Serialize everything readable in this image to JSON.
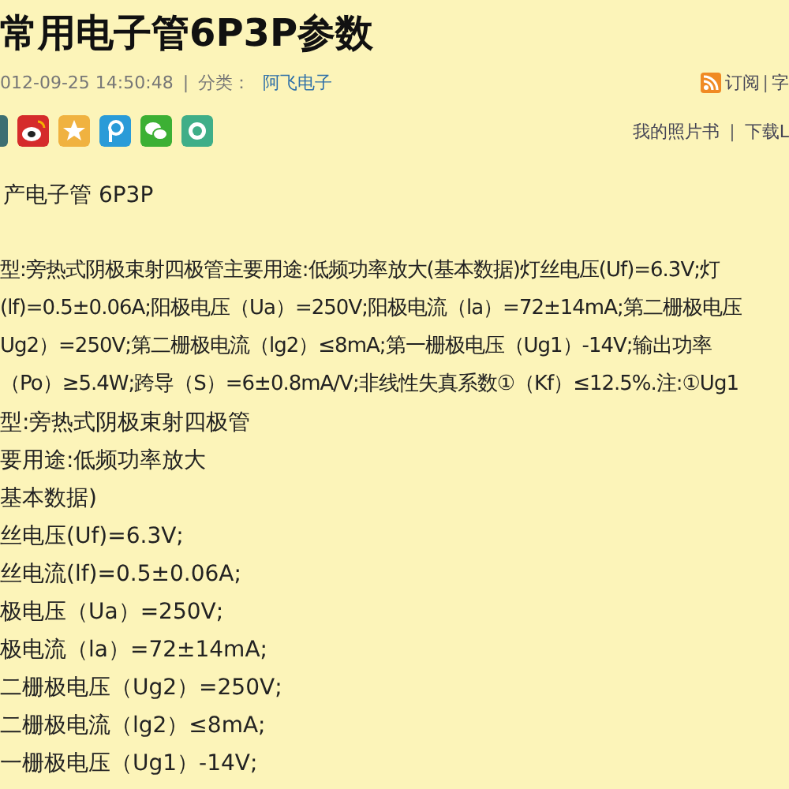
{
  "title": "常用电子管6P3P参数",
  "meta": {
    "date": "012-09-25 14:50:48",
    "separator": "|",
    "category_label": "分类：",
    "category": "阿飞电子"
  },
  "top_links": [
    "订阅",
    "|",
    "字"
  ],
  "bottom_links": [
    "我的照片书",
    "|",
    "下载L"
  ],
  "body": {
    "heading": "产电子管 6P3P",
    "paragraph": [
      "型:旁热式阴极束射四极管主要用途:低频功率放大(基本数据)灯丝电压(Uf)=6.3V;灯",
      "(lf)=0.5±0.06A;阳极电压（Ua）=250V;阳极电流（la）=72±14mA;第二栅极电压",
      "Ug2）=250V;第二栅极电流（lg2）≤8mA;第一栅极电压（Ug1）-14V;输出功率",
      "（Po）≥5.4W;跨导（S）=6±0.8mA/V;非线性失真系数①（Kf）≤12.5%.注:①Ug1"
    ],
    "lines": [
      "型:旁热式阴极束射四极管",
      "要用途:低频功率放大",
      "基本数据)",
      "丝电压(Uf)=6.3V;",
      "丝电流(lf)=0.5±0.06A;",
      "极电压（Ua）=250V;",
      "极电流（la）=72±14mA;",
      "二栅极电压（Ug2）=250V;",
      "二栅极电流（lg2）≤8mA;",
      "一栅极电压（Ug1）-14V;"
    ]
  }
}
